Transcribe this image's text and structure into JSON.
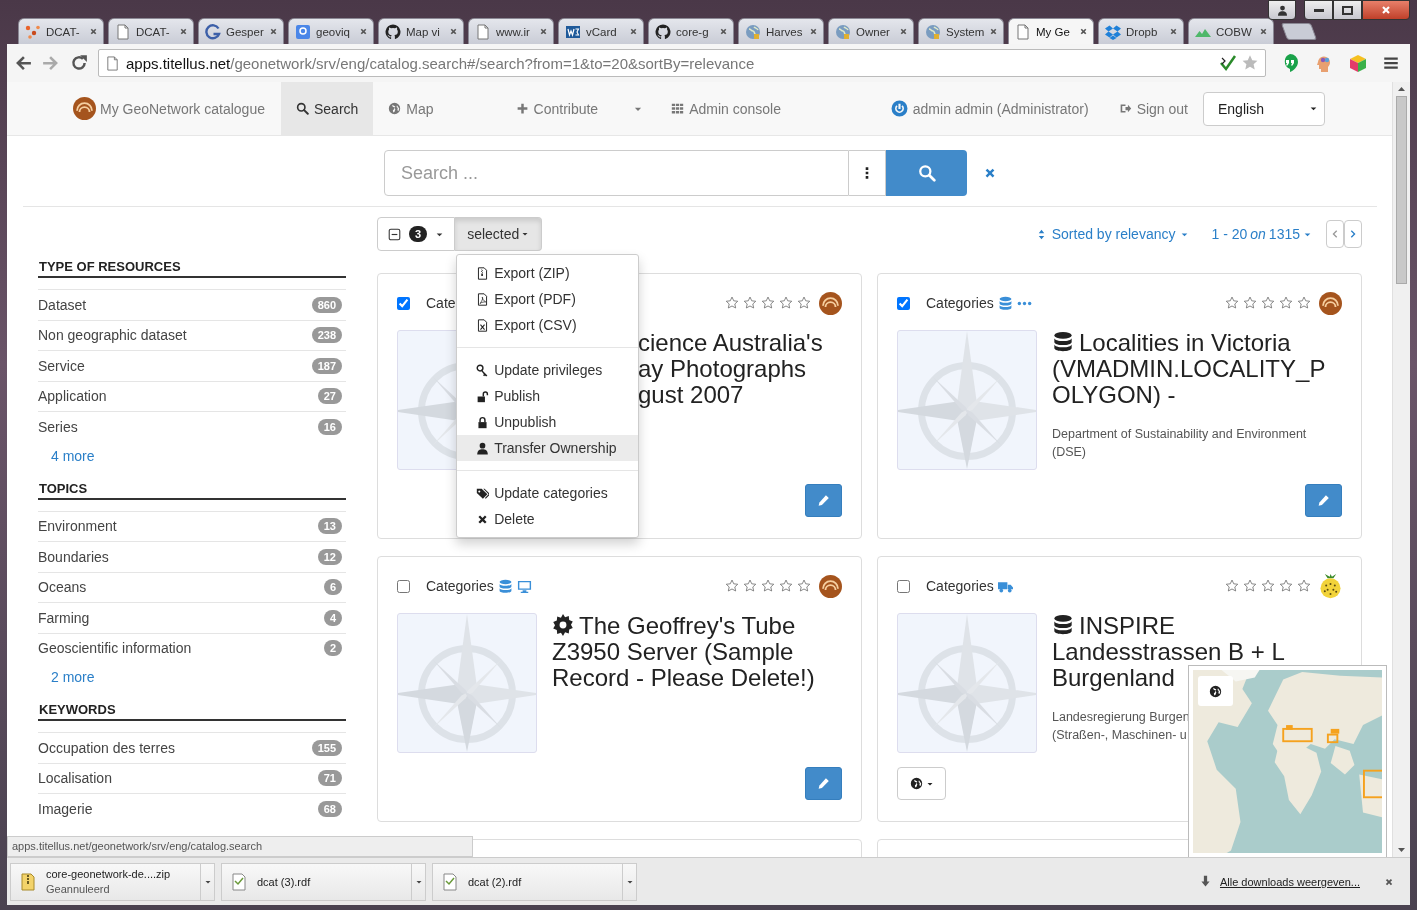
{
  "browser": {
    "tabs": [
      {
        "title": "DCAT-",
        "kind": "dots",
        "selected": false
      },
      {
        "title": "DCAT-",
        "kind": "page",
        "selected": false
      },
      {
        "title": "Gesper",
        "kind": "arc",
        "selected": false
      },
      {
        "title": "geoviq",
        "kind": "square",
        "selected": false
      },
      {
        "title": "Map vi",
        "kind": "round",
        "selected": false
      },
      {
        "title": "www.ir",
        "kind": "page",
        "selected": false
      },
      {
        "title": "vCard",
        "kind": "stripes",
        "selected": false
      },
      {
        "title": "core-g",
        "kind": "round",
        "selected": false
      },
      {
        "title": "Harves",
        "kind": "globe",
        "selected": false
      },
      {
        "title": "Owner",
        "kind": "globe",
        "selected": false
      },
      {
        "title": "System",
        "kind": "globe",
        "selected": false
      },
      {
        "title": "My Ge",
        "kind": "page",
        "selected": true
      },
      {
        "title": "Dropb",
        "kind": "box",
        "selected": false
      },
      {
        "title": "COBW",
        "kind": "hill",
        "selected": false
      }
    ],
    "address": {
      "host": "apps.titellus.net",
      "path": "/geonetwork/srv/eng/catalog.search#/search?from=1&to=20&sortBy=relevance"
    },
    "status_url": "apps.titellus.net/geonetwork/srv/eng/catalog.search",
    "downloads": [
      {
        "name": "core-geonetwork-de....zip",
        "status": "Geannuleerd",
        "kind": "zip"
      },
      {
        "name": "dcat (3).rdf",
        "kind": "file"
      },
      {
        "name": "dcat (2).rdf",
        "kind": "file"
      }
    ],
    "show_all_downloads": "Alle downloads weergeven..."
  },
  "nav": {
    "brand": "My GeoNetwork catalogue",
    "items": [
      {
        "label": "Search",
        "kind": "search",
        "selected": true,
        "dropdown": false
      },
      {
        "label": "Map",
        "kind": "globe",
        "selected": false,
        "dropdown": false
      },
      {
        "label": "Contribute",
        "kind": "plus",
        "selected": false,
        "dropdown": true
      },
      {
        "label": "Admin console",
        "kind": "grid",
        "selected": false,
        "dropdown": false
      }
    ],
    "user": "admin admin (Administrator)",
    "sign_out": "Sign out",
    "language": "English"
  },
  "search": {
    "placeholder": "Search ..."
  },
  "results_toolbar": {
    "selected_count": "3",
    "selection_button": "selected",
    "menu_open": true,
    "sort": "Sorted by relevancy",
    "paging": "1 - 20 *on* 1315"
  },
  "selection_menu": [
    [
      {
        "label": "Export (ZIP)",
        "kind": "file-zip",
        "selected": false
      },
      {
        "label": "Export (PDF)",
        "kind": "file-pdf",
        "selected": false
      },
      {
        "label": "Export (CSV)",
        "kind": "file-csv",
        "selected": false
      }
    ],
    [
      {
        "label": "Update privileges",
        "kind": "key",
        "selected": false
      },
      {
        "label": "Publish",
        "kind": "unlock",
        "selected": false
      },
      {
        "label": "Unpublish",
        "kind": "lock",
        "selected": false
      },
      {
        "label": "Transfer Ownership",
        "kind": "user",
        "selected": true
      }
    ],
    [
      {
        "label": "Update categories",
        "kind": "tags",
        "selected": false
      },
      {
        "label": "Delete",
        "kind": "x",
        "selected": false
      }
    ]
  ],
  "facets": [
    {
      "title": "TYPE OF RESOURCES",
      "items": [
        {
          "label": "Dataset",
          "count": "860"
        },
        {
          "label": "Non geographic dataset",
          "count": "238"
        },
        {
          "label": "Service",
          "count": "187"
        },
        {
          "label": "Application",
          "count": "27"
        },
        {
          "label": "Series",
          "count": "16"
        }
      ],
      "more": "4 more"
    },
    {
      "title": "TOPICS",
      "items": [
        {
          "label": "Environment",
          "count": "13"
        },
        {
          "label": "Boundaries",
          "count": "12"
        },
        {
          "label": "Oceans",
          "count": "6"
        },
        {
          "label": "Farming",
          "count": "4"
        },
        {
          "label": "Geoscientific information",
          "count": "2"
        }
      ],
      "more": "2 more"
    },
    {
      "title": "KEYWORDS",
      "items": [
        {
          "label": "Occupation des terres",
          "count": "155"
        },
        {
          "label": "Localisation",
          "count": "71"
        },
        {
          "label": "Imagerie",
          "count": "68"
        }
      ]
    }
  ],
  "results": [
    {
      "checked": true,
      "categories": "Cate",
      "stars": 0,
      "logo": {
        "kind": "ring",
        "color": "#a5541d"
      },
      "covered": true,
      "title_lines": [
        "cience Australia's",
        "ay Photographs",
        "gust 2007"
      ],
      "button": {
        "kind": "edit"
      }
    },
    {
      "checked": true,
      "categories": "Categories",
      "category_icons": [
        {
          "kind": "database"
        },
        {
          "kind": "more"
        }
      ],
      "stars": 0,
      "logo": {
        "kind": "ring",
        "color": "#a5541d"
      },
      "kind": "dataset",
      "covered": false,
      "title_lines": [
        "Localities in Victoria",
        "(VMADMIN.LOCALITY_P",
        "OLYGON) -"
      ],
      "org_lines": [
        "Department of Sustainability and Environment",
        "(DSE)"
      ],
      "button": {
        "kind": "edit"
      }
    },
    {
      "checked": false,
      "categories": "Categories",
      "category_icons": [
        {
          "kind": "database"
        },
        {
          "kind": "monitor"
        }
      ],
      "stars": 0,
      "logo": {
        "kind": "ring",
        "color": "#a5541d"
      },
      "kind": "service",
      "covered": false,
      "title_lines": [
        "The Geoffrey's Tube",
        "Z3950 Server (Sample",
        "Record - Please Delete!)"
      ],
      "button": {
        "kind": "edit"
      }
    },
    {
      "checked": false,
      "categories": "Categories",
      "category_icons": [
        {
          "kind": "truck"
        }
      ],
      "stars": 0,
      "logo": {
        "kind": "dotted",
        "color": "#f2d33a"
      },
      "kind": "dataset",
      "covered": false,
      "title_lines": [
        "INSPIRE",
        "Landesstrassen B + L",
        "Burgenland"
      ],
      "org_lines": [
        "Landesregierung Burgen",
        "(Straßen-, Maschinen- u"
      ],
      "button": {
        "kind": "map"
      }
    }
  ],
  "map_overlay": {
    "kind": "picture"
  }
}
